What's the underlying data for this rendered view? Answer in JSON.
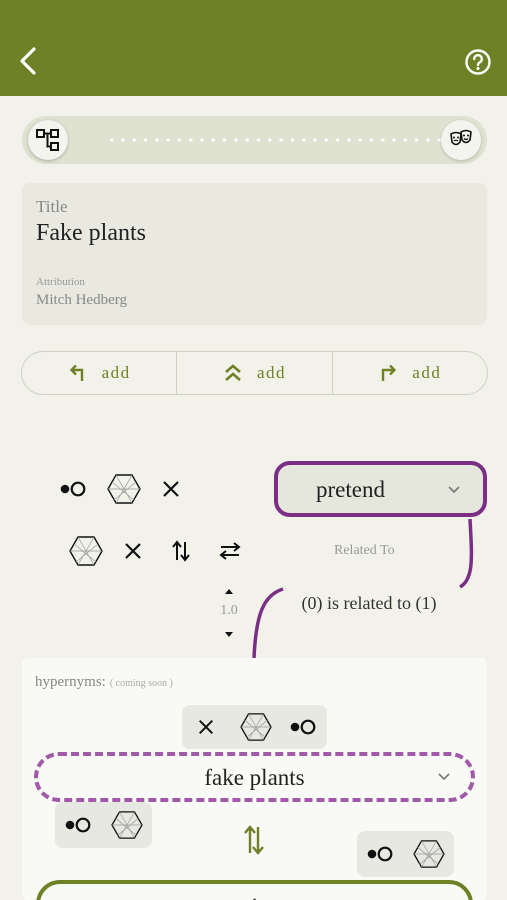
{
  "header": {
    "back_icon": "chevron-left-icon",
    "help_icon": "question-circle-icon",
    "color": "#6f8126"
  },
  "progress": {
    "start_icon": "hierarchy-icon",
    "end_icon": "theater-masks-icon",
    "dot_count": 30
  },
  "card": {
    "title_label": "Title",
    "title_value": "Fake plants",
    "attribution_label": "Attribution",
    "attribution_value": "Mitch Hedberg"
  },
  "add_bar": [
    {
      "icon": "turn-up-left-arrow-icon",
      "label": "add"
    },
    {
      "icon": "double-chevron-up-icon",
      "label": "add"
    },
    {
      "icon": "turn-up-right-arrow-icon",
      "label": "add"
    }
  ],
  "relation": {
    "selected": "pretend",
    "related_to_label": "Related To",
    "description": "(0) is related to (1)",
    "weight": "1.0",
    "accent": "#7a2e84"
  },
  "hypernyms": {
    "label": "hypernyms:",
    "note": "( coming soon )",
    "term": "fake plants",
    "next_term_partial": "."
  }
}
